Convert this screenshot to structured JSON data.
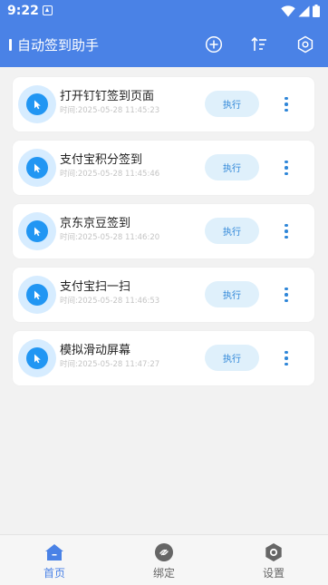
{
  "status_bar": {
    "time": "9:22"
  },
  "app_bar": {
    "title": "自动签到助手"
  },
  "tasks": [
    {
      "name": "打开钉钉签到页面",
      "time": "时间:2025-05-28 11:45:23",
      "action": "执行"
    },
    {
      "name": "支付宝积分签到",
      "time": "时间:2025-05-28 11:45:46",
      "action": "执行"
    },
    {
      "name": "京东京豆签到",
      "time": "时间:2025-05-28 11:46:20",
      "action": "执行"
    },
    {
      "name": "支付宝扫一扫",
      "time": "时间:2025-05-28 11:46:53",
      "action": "执行"
    },
    {
      "name": "模拟滑动屏幕",
      "time": "时间:2025-05-28 11:47:27",
      "action": "执行"
    }
  ],
  "bottom_nav": {
    "home": "首页",
    "bind": "绑定",
    "settings": "设置"
  },
  "colors": {
    "primary": "#4a82e6",
    "accent_blue": "#2196f3",
    "exec_bg": "#dff0fb",
    "exec_text": "#2e86d8"
  }
}
